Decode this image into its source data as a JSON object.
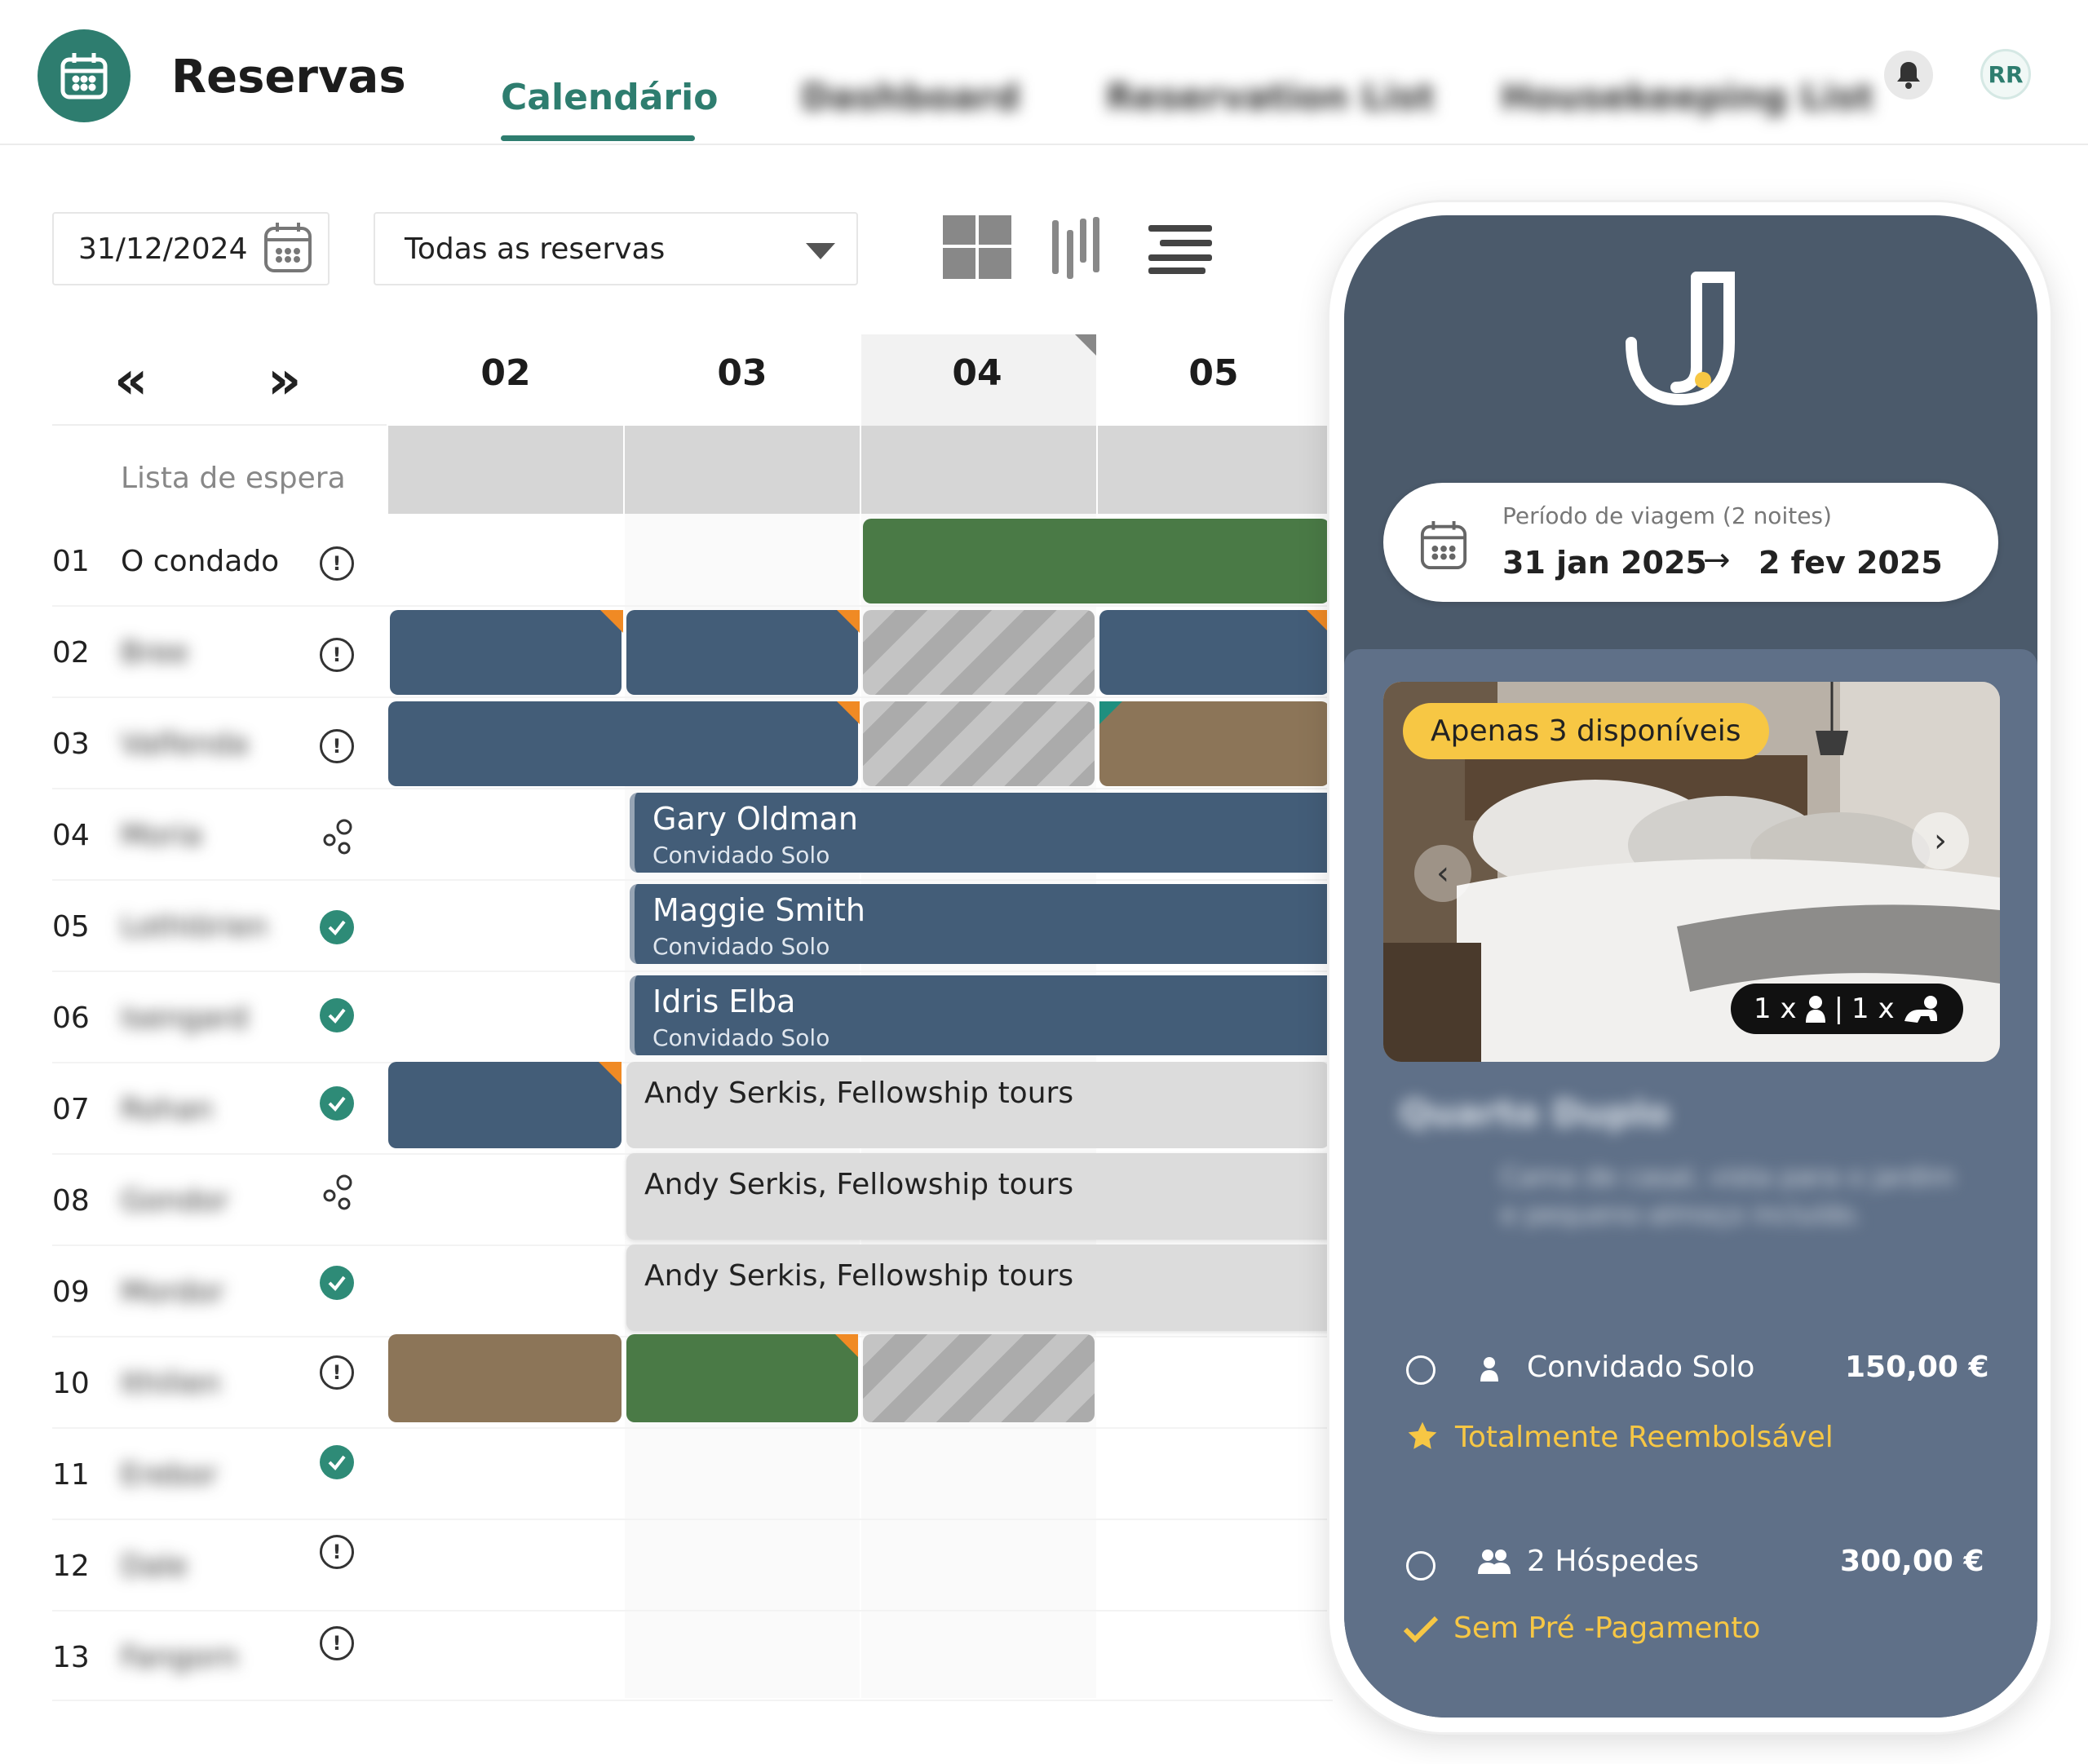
{
  "header": {
    "title": "Reservas",
    "tabs": [
      {
        "label": "Calendário",
        "active": true
      },
      {
        "label": "Dashboard",
        "blurred": true
      },
      {
        "label": "Reservation List",
        "blurred": true
      },
      {
        "label": "Housekeeping List",
        "blurred": true
      }
    ],
    "avatar_initials": "RR",
    "icons": {
      "logo": "calendar-icon",
      "notifications": "bell-icon"
    }
  },
  "toolbar": {
    "date_value": "31/12/2024",
    "filter_value": "Todas as reservas",
    "views": [
      "grid-view-icon",
      "columns-view-icon",
      "list-view-icon"
    ]
  },
  "calendar": {
    "nav": {
      "prev": "«",
      "next": "»"
    },
    "days": [
      "02",
      "03",
      "04",
      "05"
    ],
    "today": "04",
    "waitlist_label": "Lista de espera",
    "rooms": [
      {
        "num": "01",
        "name": "O condado",
        "status": "warning"
      },
      {
        "num": "02",
        "name": "Bree",
        "status": "warning",
        "blurred": true
      },
      {
        "num": "03",
        "name": "Valfenda",
        "status": "warning",
        "blurred": true
      },
      {
        "num": "04",
        "name": "Moria",
        "status": "group",
        "blurred": true
      },
      {
        "num": "05",
        "name": "Lothlórien",
        "status": "ok",
        "blurred": true
      },
      {
        "num": "06",
        "name": "Isengard",
        "status": "ok",
        "blurred": true
      },
      {
        "num": "07",
        "name": "Rohan",
        "status": "ok",
        "blurred": true
      },
      {
        "num": "08",
        "name": "Gondor",
        "status": "group",
        "blurred": true
      },
      {
        "num": "09",
        "name": "Mordor",
        "status": "ok",
        "blurred": true
      },
      {
        "num": "10",
        "name": "Ithilien",
        "status": "warning",
        "blurred": true
      },
      {
        "num": "11",
        "name": "Erebor",
        "status": "ok",
        "blurred": true
      },
      {
        "num": "12",
        "name": "Dale",
        "status": "warning",
        "blurred": true
      },
      {
        "num": "13",
        "name": "Fangorn",
        "status": "warning",
        "blurred": true
      }
    ],
    "guests": {
      "gary": {
        "name": "Gary Oldman",
        "type": "Convidado Solo"
      },
      "maggie": {
        "name": "Maggie Smith",
        "type": "Convidado Solo"
      },
      "idris": {
        "name": "Idris Elba",
        "type": "Convidado Solo"
      },
      "andy": "Andy Serkis, Fellowship tours"
    },
    "colors": {
      "blue": "#435d78",
      "green": "#4a7a46",
      "brown": "#8c7558",
      "accent": "#2e7d6f",
      "flag_orange": "#f08a24",
      "flag_teal": "#1f8f7f"
    }
  },
  "booking_widget": {
    "period_label": "Período de viagem (2 noites)",
    "from": "31 jan 2025",
    "arrow": "→",
    "to": "2 fev 2025",
    "availability_badge": "Apenas 3 disponíveis",
    "occupancy": {
      "adults": "1 x",
      "separator": "|",
      "children": "1 x"
    },
    "room_title": "Quarto Duplo",
    "room_description": "Cama de casal, vista para o jardim e pequeno-almoço incluído.",
    "options": [
      {
        "label": "Convidado Solo",
        "price": "150,00 €",
        "tag": "Totalmente Reembolsável",
        "tag_icon": "star-icon",
        "icon": "person-icon"
      },
      {
        "label": "2 Hóspedes",
        "price": "300,00 €",
        "tag": "Sem Pré -Pagamento",
        "tag_icon": "check-icon",
        "icon": "people-icon"
      }
    ],
    "colors": {
      "phone_top": "#4b5a6b",
      "phone_body": "#5f7088",
      "badge": "#f7c744"
    }
  }
}
